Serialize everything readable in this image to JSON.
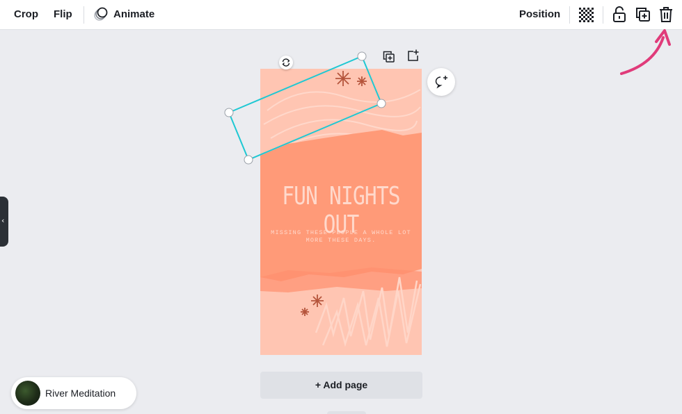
{
  "toolbar": {
    "crop_label": "Crop",
    "flip_label": "Flip",
    "animate_label": "Animate",
    "position_label": "Position",
    "icons": [
      "animate-icon",
      "transparency-icon",
      "lock-icon",
      "duplicate-icon",
      "trash-icon"
    ]
  },
  "page": {
    "headline": "FUN NIGHTS OUT",
    "subline": "MISSING THESE PEOPLE A WHOLE LOT MORE THESE DAYS.",
    "background_color": "#ffc5b2",
    "brush_color": "#ff9a78",
    "star_color": "#b5553c"
  },
  "canvas": {
    "add_page_label": "+ Add page",
    "selection_color": "#1fc8d3",
    "side_toggle_glyph": "‹"
  },
  "media": {
    "audio_title": "River Meditation"
  },
  "annotation": {
    "arrow_color": "#e03b7a",
    "points_to": "trash-icon"
  }
}
